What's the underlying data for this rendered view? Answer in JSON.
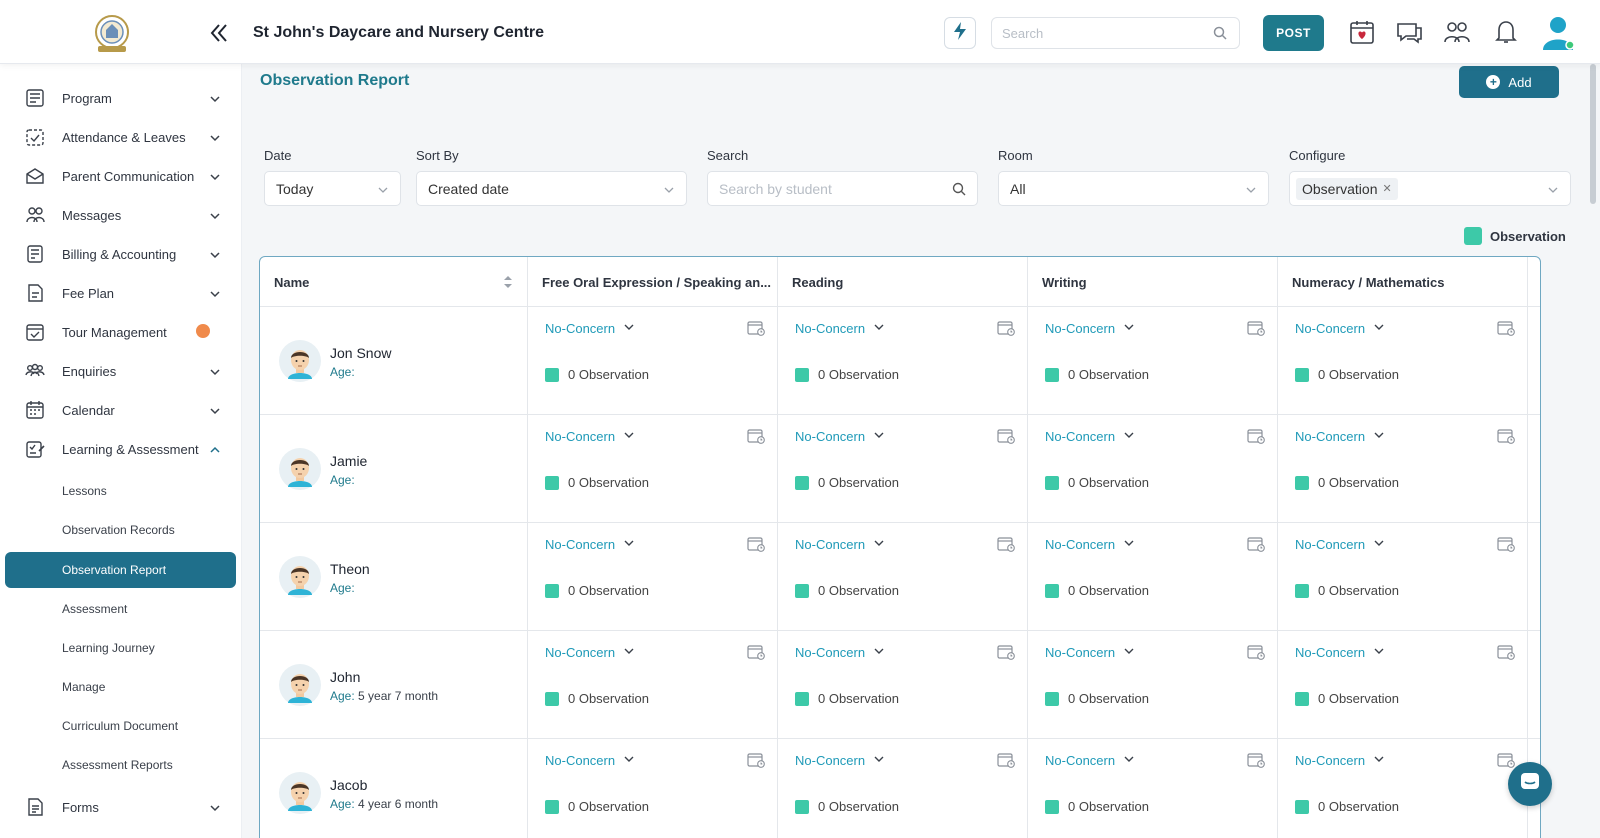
{
  "header": {
    "org_title": "St John's Daycare and Nursery Centre",
    "search_placeholder": "Search",
    "post_label": "POST"
  },
  "sidebar": {
    "items": [
      {
        "label": "Program",
        "icon": "program-icon"
      },
      {
        "label": "Attendance & Leaves",
        "icon": "attendance-icon"
      },
      {
        "label": "Parent Communication",
        "icon": "parent-communication-icon"
      },
      {
        "label": "Messages",
        "icon": "messages-icon"
      },
      {
        "label": "Billing & Accounting",
        "icon": "billing-icon"
      },
      {
        "label": "Fee Plan",
        "icon": "fee-plan-icon"
      },
      {
        "label": "Tour Management",
        "icon": "tour-icon"
      },
      {
        "label": "Enquiries",
        "icon": "enquiries-icon"
      },
      {
        "label": "Calendar",
        "icon": "calendar-icon"
      },
      {
        "label": "Learning & Assessment",
        "icon": "learning-icon"
      }
    ],
    "sub_items": [
      {
        "label": "Lessons"
      },
      {
        "label": "Observation Records"
      },
      {
        "label": "Observation Report"
      },
      {
        "label": "Assessment"
      },
      {
        "label": "Learning Journey"
      },
      {
        "label": "Manage"
      },
      {
        "label": "Curriculum Document"
      },
      {
        "label": "Assessment Reports"
      }
    ],
    "forms_label": "Forms"
  },
  "page": {
    "title": "Observation Report",
    "add_label": "Add"
  },
  "filters": {
    "date_label": "Date",
    "date_value": "Today",
    "sort_label": "Sort By",
    "sort_value": "Created date",
    "search_label": "Search",
    "search_placeholder": "Search by student",
    "room_label": "Room",
    "room_value": "All",
    "configure_label": "Configure",
    "configure_chip": "Observation"
  },
  "legend": {
    "label": "Observation",
    "color": "#3dc9a8"
  },
  "table": {
    "name_header": "Name",
    "columns": [
      "Free Oral Expression / Speaking an...",
      "Reading",
      "Writing",
      "Numeracy / Mathematics"
    ],
    "concern_label": "No-Concern",
    "observation_label": "0 Observation",
    "age_label": "Age:",
    "rows": [
      {
        "name": "Jon Snow",
        "age": ""
      },
      {
        "name": "Jamie",
        "age": ""
      },
      {
        "name": "Theon",
        "age": ""
      },
      {
        "name": "John",
        "age": "5 year 7 month"
      },
      {
        "name": "Jacob",
        "age": "4 year 6 month"
      }
    ]
  },
  "colors": {
    "primary": "#1f6f8b",
    "accent_text": "#1f7a8c",
    "link": "#1f9ab8",
    "observation": "#3dc9a8"
  }
}
